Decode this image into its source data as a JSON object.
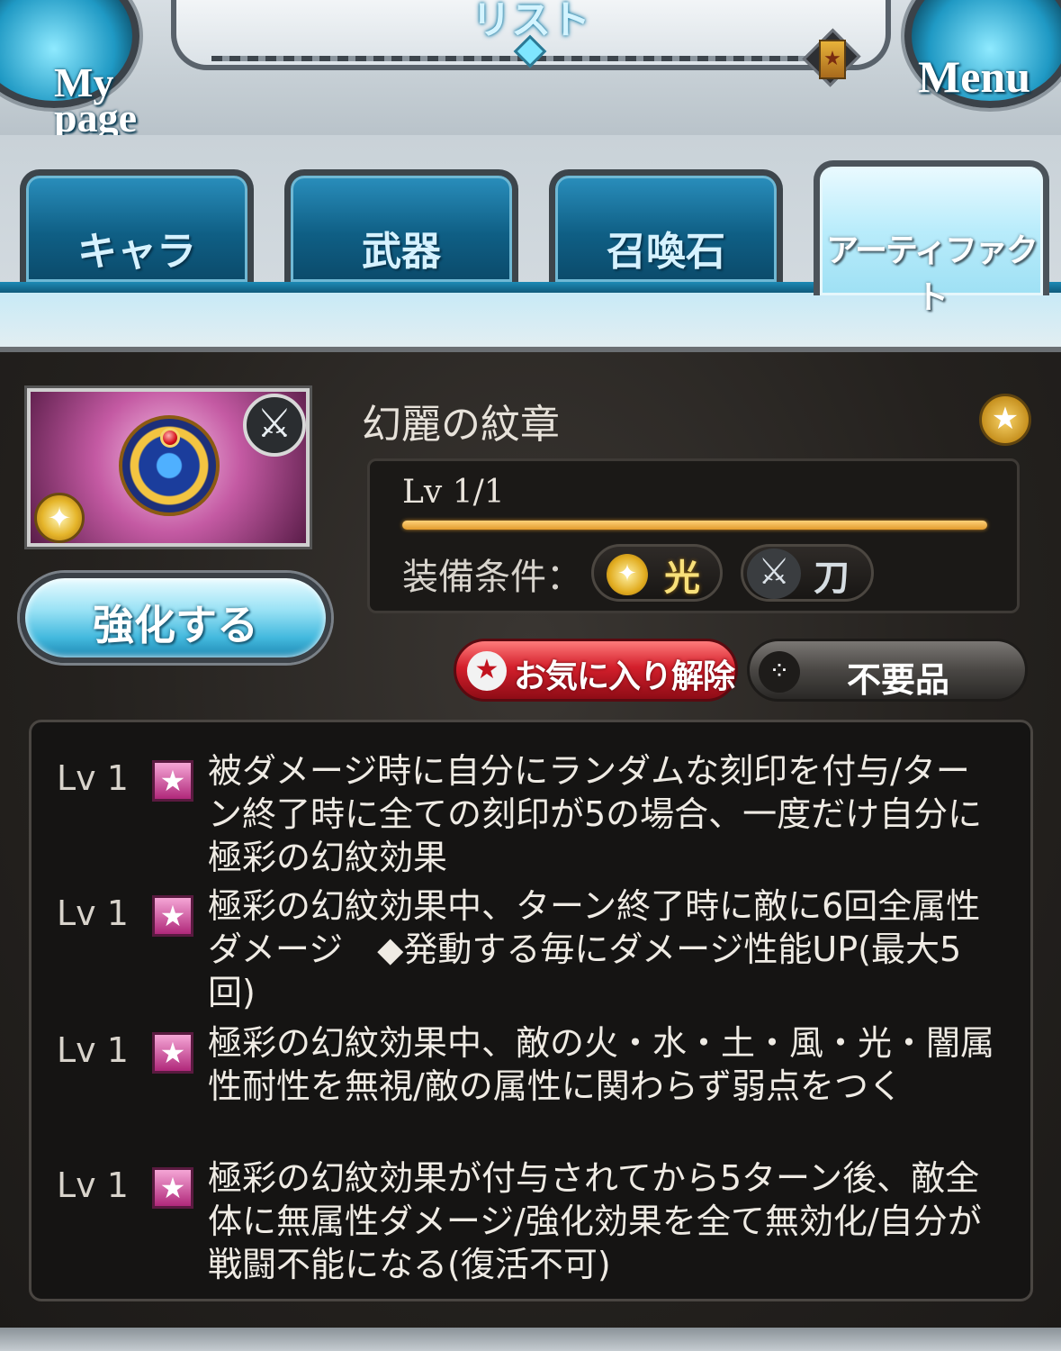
{
  "header": {
    "title": "リスト",
    "mypage_line1": "My",
    "mypage_line2": "page",
    "menu_label": "Menu"
  },
  "tabs": [
    {
      "label": "キャラ",
      "active": false
    },
    {
      "label": "武器",
      "active": false
    },
    {
      "label": "召喚石",
      "active": false
    },
    {
      "label": "アーティファクト",
      "active": true
    }
  ],
  "artifact": {
    "name": "幻麗の紋章",
    "level": "Lv 1/1",
    "level_progress": 1.0,
    "equip_label": "装備条件：",
    "element": "光",
    "weapon_type": "刀",
    "upgrade_label": "強化する",
    "fav_remove_label": "お気に入り解除",
    "junk_label": "不要品"
  },
  "skills": [
    {
      "lv": "Lv 1",
      "text": "被ダメージ時に自分にランダムな刻印を付与/ターン終了時に全ての刻印が5の場合、一度だけ自分に極彩の幻紋効果"
    },
    {
      "lv": "Lv 1",
      "text": "極彩の幻紋効果中、ターン終了時に敵に6回全属性ダメージ　◆発動する毎にダメージ性能UP(最大5回)"
    },
    {
      "lv": "Lv 1",
      "text": "極彩の幻紋効果中、敵の火・水・土・風・光・闇属性耐性を無視/敵の属性に関わらず弱点をつく"
    },
    {
      "lv": "Lv 1",
      "text": "極彩の幻紋効果が付与されてから5ターン後、敵全体に無属性ダメージ/強化効果を全て無効化/自分が戦闘不能になる(復活不可)"
    }
  ],
  "colors": {
    "accent_blue": "#1f99c4",
    "fav_red": "#d31f2b",
    "level_bar": "#e29b2c"
  }
}
